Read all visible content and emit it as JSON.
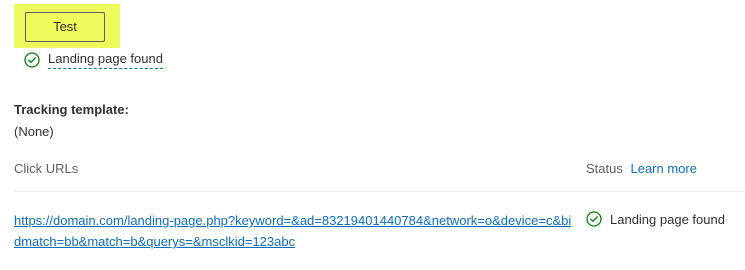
{
  "test_button": {
    "label": "Test"
  },
  "test_result": {
    "text": "Landing page found",
    "icon": "check-circle-icon",
    "color": "#107c10"
  },
  "tracking_template": {
    "label": "Tracking template:",
    "value": "(None)"
  },
  "table": {
    "columns": {
      "click_urls": "Click URLs",
      "status": "Status",
      "learn_more": "Learn more"
    },
    "rows": [
      {
        "url": "https://domain.com/landing-page.php?keyword=&ad=83219401440784&network=o&device=c&bidmatch=bb&match=b&querys=&msclkid=123abc",
        "status": "Landing page found"
      }
    ]
  },
  "colors": {
    "highlight": "#eefb5c",
    "link": "#0f6cbd",
    "success": "#107c10"
  }
}
